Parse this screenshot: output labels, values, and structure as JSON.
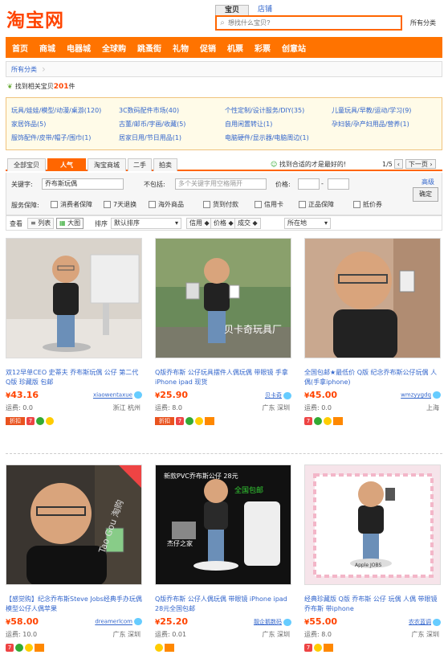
{
  "logo": "淘宝网",
  "search": {
    "tabs": [
      "宝贝",
      "店铺"
    ],
    "placeholder": "想找什么宝贝?",
    "category": "所有分类"
  },
  "nav": [
    "首页",
    "商城",
    "电器城",
    "全球购",
    "跳蚤街",
    "礼物",
    "促销",
    "机票",
    "彩票",
    "创意站"
  ],
  "breadcrumb": "所有分类",
  "found": {
    "prefix": "找到相关宝贝",
    "count": "201",
    "suffix": "件"
  },
  "categories": [
    [
      "玩具/娃娃/模型/动漫/桌游(120)",
      "3C数码配件市场(40)",
      "个性定制/设计服务/DIY(35)",
      "儿童玩具/早教/运动/学习(9)"
    ],
    [
      "家居饰品(5)",
      "古董/邮币/字画/收藏(5)",
      "自用闲置转让(1)",
      "孕妇装/孕产妇用品/营养(1)"
    ],
    [
      "服饰配件/皮带/帽子/围巾(1)",
      "居家日用/节日用品(1)",
      "电脑硬件/显示器/电脑周边(1)",
      ""
    ]
  ],
  "filter_tabs": [
    "全部宝贝",
    "人气",
    "淘宝商城",
    "二手",
    "拍卖"
  ],
  "tip": "找到合适的才是最好的!",
  "pager": {
    "page": "1/5",
    "next": "下一页"
  },
  "filter": {
    "keyword_label": "关键字:",
    "keyword": "乔布斯玩偶",
    "exclude_label": "不包括:",
    "exclude_placeholder": "多个关键字用空格隔开",
    "price_label": "价格:",
    "price_sep": "-",
    "advanced": "高级",
    "confirm": "确定",
    "service_label": "服务保障:",
    "services": [
      "消费者保障",
      "7天退换",
      "海外商品",
      "货到付款",
      "信用卡",
      "正品保障",
      "抵价券"
    ]
  },
  "sort": {
    "view_label": "查看",
    "list": "列表",
    "grid": "大图",
    "sort_label": "排序",
    "sort_value": "默认排序",
    "credit": "信用",
    "price": "价格",
    "sales": "成交",
    "location": "所在地"
  },
  "products": [
    {
      "title": "双12早单CEO 史蒂夫 乔布斯玩偶 公仔 第二代 Q版 珍藏版 包邮",
      "price": "43.16",
      "seller": "xiaowentaxue",
      "freight": "运费: 0.0",
      "location": "浙江 杭州",
      "badge": "折扣"
    },
    {
      "title": "Q版乔布斯 公仔玩具摆件人偶玩偶 带眼镜 手拿iPhone ipad 现货",
      "price": "25.90",
      "seller": "贝卡奇",
      "freight": "运费: 8.0",
      "location": "广东 深圳",
      "badge": "折扣"
    },
    {
      "title": "全国包邮★最低价 Q版 纪念乔布斯公仔玩偶 人偶(手拿iphone)",
      "price": "45.00",
      "seller": "wmzyygdq",
      "freight": "运费: 0.0",
      "location": "上海",
      "badge": ""
    },
    {
      "title": "【感觉购】纪念乔布斯Steve Jobs经典手办玩偶模型公仔人偶苹果",
      "price": "58.00",
      "seller": "dreamerlcom",
      "freight": "运费: 10.0",
      "location": "广东 深圳",
      "badge": ""
    },
    {
      "title": "Q版乔布斯 公仔人偶玩偶 带眼镜 iPhone ipad 28元全国包邮",
      "price": "25.20",
      "seller": "靓企鹅数码",
      "freight": "运费: 0.01",
      "location": "广东 深圳",
      "badge": ""
    },
    {
      "title": "经典珍藏版 Q版 乔布斯 公仔 玩偶 人偶 带眼镜 乔布斯 带iphone",
      "price": "55.00",
      "seller": "农农蓝调",
      "freight": "运费: 8.0",
      "location": "广东 深圳",
      "badge": ""
    }
  ],
  "photo_texts": {
    "p2": "贝卡奇玩具厂",
    "p4": "Tao Gou 淘购",
    "p5": "新款PVC乔布斯公仔 28元",
    "p5b": "全国包邮",
    "p5c": "杰仔之家",
    "p6": "Apple JOBS"
  },
  "colors": {
    "accent": "#ff7300",
    "price": "#ff4400",
    "link": "#3366cc"
  }
}
